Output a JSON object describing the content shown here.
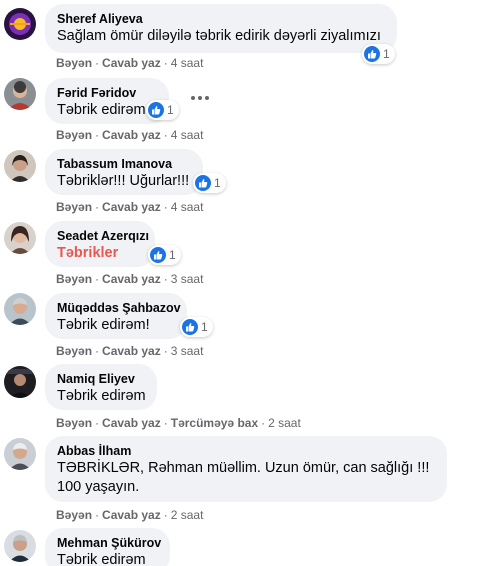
{
  "colors": {
    "bubble": "#f0f2f5",
    "like": "#1b74e4",
    "meta": "#65676b",
    "highlight": "#e8584f"
  },
  "comments": [
    {
      "author": "Sheref Aliyeva",
      "text": "Sağlam ömür diləyilə təbrik edirik dəyərli ziyalımızı",
      "reactions": "1",
      "like": "Bəyən",
      "reply": "Cavab yaz",
      "time": "4 saat"
    },
    {
      "author": "Fərid Fəridov",
      "text": "Təbrik edirəm",
      "reactions": "1",
      "like": "Bəyən",
      "reply": "Cavab yaz",
      "time": "4 saat"
    },
    {
      "author": "Tabassum Imanova",
      "text": "Təbriklər!!! Uğurlar!!!",
      "reactions": "1",
      "like": "Bəyən",
      "reply": "Cavab yaz",
      "time": "4 saat"
    },
    {
      "author": "Seadet Azerqızı",
      "text": "Təbrikler",
      "reactions": "1",
      "like": "Bəyən",
      "reply": "Cavab yaz",
      "time": "3 saat"
    },
    {
      "author": "Müqəddəs Şahbazov",
      "text": "Təbrik edirəm!",
      "reactions": "1",
      "like": "Bəyən",
      "reply": "Cavab yaz",
      "time": "3 saat"
    },
    {
      "author": "Namiq Eliyev",
      "text": "Təbrik edirəm",
      "like": "Bəyən",
      "reply": "Cavab yaz",
      "translate": "Tərcüməyə bax",
      "time": "2 saat"
    },
    {
      "author": "Abbas İlham",
      "text": "TƏBRİKLƏR, Rəhman müəllim. Uzun ömür, can sağlığı !!! 100 yaşayın.",
      "like": "Bəyən",
      "reply": "Cavab yaz",
      "time": "2 saat"
    },
    {
      "author": "Mehman Şükürov",
      "text": "Təbrik edirəm"
    }
  ],
  "icons": {
    "like": "thumbs-up-icon",
    "more": "more-options-icon"
  }
}
